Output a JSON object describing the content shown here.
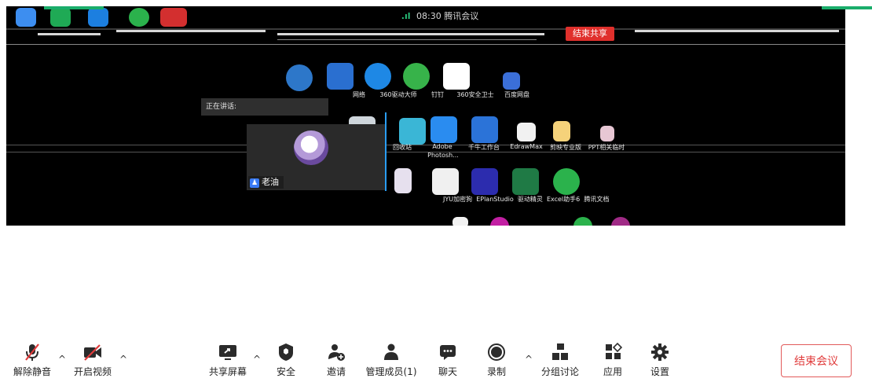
{
  "shared_screen": {
    "status_time": "08:30",
    "status_app": "腾讯会议",
    "end_share_label": "结束共享",
    "desktop_icons_row1": [
      "网络",
      "360驱动大师",
      "钉钉",
      "360安全卫士",
      "百度网盘"
    ],
    "desktop_icons_row2": [
      "回收站",
      "Adobe",
      "千牛工作台",
      "EdrawMax",
      "剪映专业版",
      "PPT相关临时"
    ],
    "desktop_icons_row2_sub": "Photosh...",
    "desktop_icons_row3": [
      "JYU加密狗",
      "EPlanStudio",
      "驱动精灵",
      "Excel助手6",
      "腾讯文档"
    ]
  },
  "speaker": {
    "header_label": "正在讲话:",
    "name": "老油"
  },
  "toolbar": {
    "unmute": "解除静音",
    "start_video": "开启视频",
    "share_screen": "共享屏幕",
    "security": "安全",
    "invite": "邀请",
    "manage_members": "管理成员(1)",
    "chat": "聊天",
    "record": "录制",
    "breakout": "分组讨论",
    "apps": "应用",
    "settings": "设置",
    "end_meeting": "结束会议"
  },
  "colors": {
    "accent_green": "#1aad6b",
    "end_red": "#e03b3b",
    "icon_dark": "#2b2b2b"
  }
}
